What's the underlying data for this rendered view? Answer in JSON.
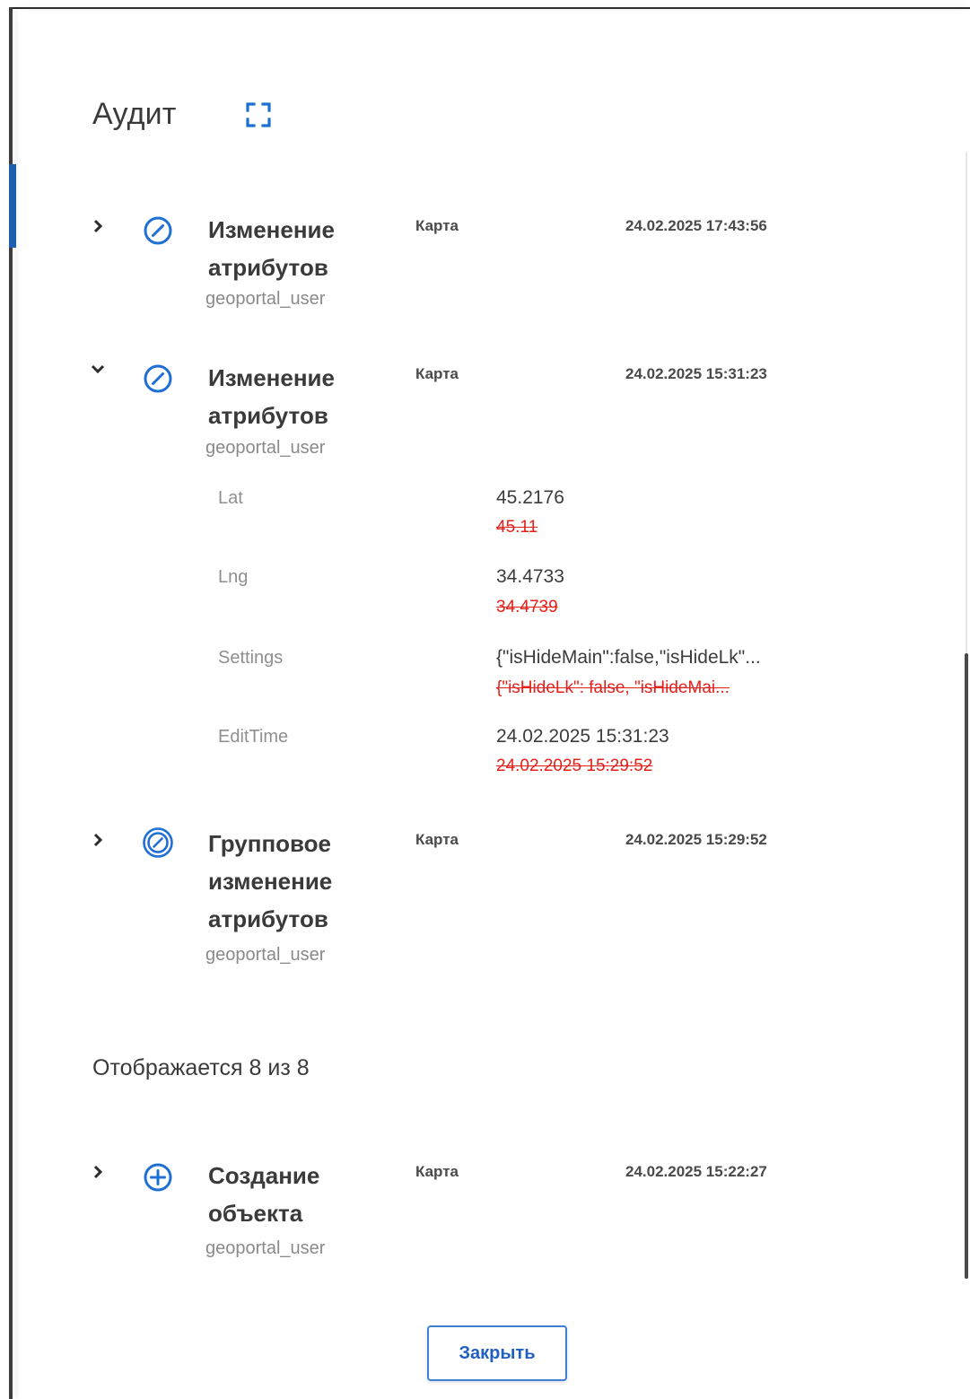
{
  "dialog": {
    "title": "Аудит",
    "expand_icon": "fullscreen-icon",
    "accent_color": "#1f6fd6",
    "old_value_color": "#e5201a"
  },
  "entries": [
    {
      "expanded": false,
      "icon": "edit-circle-icon",
      "action": "Изменение атрибутов",
      "user": "geoportal_user",
      "layer": "Карта",
      "timestamp": "24.02.2025 17:43:56"
    },
    {
      "expanded": true,
      "icon": "edit-circle-icon",
      "action": "Изменение атрибутов",
      "user": "geoportal_user",
      "layer": "Карта",
      "timestamp": "24.02.2025 15:31:23",
      "changes": [
        {
          "name": "Lat",
          "new": "45.2176",
          "old": "45.11"
        },
        {
          "name": "Lng",
          "new": "34.4733",
          "old": "34.4739"
        },
        {
          "name": "Settings",
          "new": "{\"isHideMain\":false,\"isHideLk\"...",
          "old": "{\"isHideLk\": false, \"isHideMai..."
        },
        {
          "name": "EditTime",
          "new": "24.02.2025 15:31:23",
          "old": "24.02.2025 15:29:52"
        }
      ]
    },
    {
      "expanded": false,
      "icon": "group-edit-circle-icon",
      "action": "Групповое изменение атрибутов",
      "user": "geoportal_user",
      "layer": "Карта",
      "timestamp": "24.02.2025 15:29:52"
    },
    {
      "expanded": false,
      "icon": "plus-circle-icon",
      "action": "Создание объекта",
      "user": "geoportal_user",
      "layer": "Карта",
      "timestamp": "24.02.2025 15:22:27"
    }
  ],
  "pagination": {
    "summary": "Отображается 8 из 8"
  },
  "footer": {
    "close_label": "Закрыть"
  }
}
